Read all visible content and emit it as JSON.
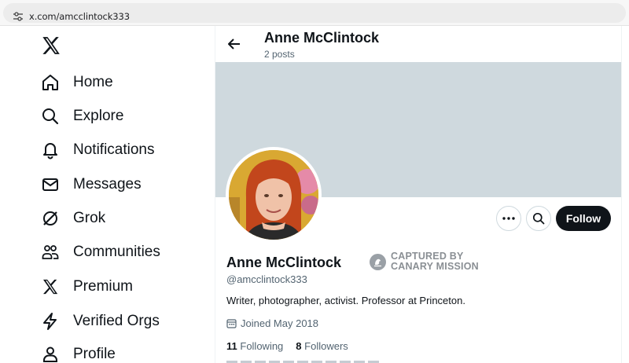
{
  "browser": {
    "url": "x.com/amcclintock333",
    "site_info_icon": "tune-icon"
  },
  "sidebar": {
    "logo_icon": "x-logo-icon",
    "items": [
      {
        "label": "Home",
        "icon": "home-icon"
      },
      {
        "label": "Explore",
        "icon": "search-icon"
      },
      {
        "label": "Notifications",
        "icon": "bell-icon"
      },
      {
        "label": "Messages",
        "icon": "envelope-icon"
      },
      {
        "label": "Grok",
        "icon": "grok-icon"
      },
      {
        "label": "Communities",
        "icon": "people-icon"
      },
      {
        "label": "Premium",
        "icon": "x-icon"
      },
      {
        "label": "Verified Orgs",
        "icon": "lightning-icon"
      },
      {
        "label": "Profile",
        "icon": "person-icon"
      }
    ]
  },
  "header": {
    "name": "Anne McClintock",
    "posts": "2 posts"
  },
  "profile": {
    "name": "Anne McClintock",
    "handle": "@amcclintock333",
    "bio": "Writer, photographer, activist. Professor at Princeton.",
    "joined": "Joined May 2018",
    "following_count": "11",
    "following_label": "Following",
    "followers_count": "8",
    "followers_label": "Followers",
    "follow_button": "Follow"
  },
  "badge": {
    "line1": "CAPTURED BY",
    "line2": "CANARY MISSION"
  },
  "colors": {
    "banner": "#cfd9de",
    "follow_bg": "#0f1419",
    "secondary_text": "#536471"
  }
}
